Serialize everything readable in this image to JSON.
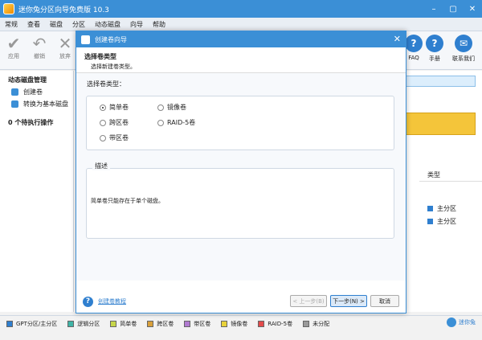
{
  "app": {
    "title": "迷你兔分区向导免费版 10.3"
  },
  "window_controls": [
    "–",
    "▢",
    "✕"
  ],
  "menu": [
    "常规",
    "查看",
    "磁盘",
    "分区",
    "动态磁盘",
    "向导",
    "帮助"
  ],
  "toolbar": {
    "left": [
      {
        "label": "应用",
        "icon": "check-icon"
      },
      {
        "label": "撤销",
        "icon": "undo-icon"
      },
      {
        "label": "放弃",
        "icon": "discard-icon"
      }
    ],
    "right": [
      {
        "label": "FAQ",
        "icon": "faq-icon"
      },
      {
        "label": "手册",
        "icon": "manual-icon"
      },
      {
        "label": "联系我们",
        "icon": "contact-icon"
      }
    ]
  },
  "sidebar": {
    "heading": "动态磁盘管理",
    "items": [
      {
        "label": "创建卷",
        "icon": "create-volume-icon"
      },
      {
        "label": "转换为基本磁盘",
        "icon": "convert-basic-icon"
      }
    ],
    "pending": "0 个待执行操作"
  },
  "main": {
    "type_header": "类型",
    "type_rows": [
      "主分区",
      "主分区"
    ]
  },
  "dialog": {
    "title": "创建卷向导",
    "header_title": "选择卷类型",
    "header_subtitle": "选择新建卷类型。",
    "section_label": "选择卷类型：",
    "options": [
      {
        "label": "简单卷",
        "selected": true
      },
      {
        "label": "镜像卷",
        "selected": false
      },
      {
        "label": "跨区卷",
        "selected": false
      },
      {
        "label": "RAID-5卷",
        "selected": false
      },
      {
        "label": "带区卷",
        "selected": false
      }
    ],
    "desc_label": "描述",
    "desc_text": "简单卷只能存在于单个磁盘。",
    "help_link": "创建卷教程",
    "buttons": {
      "back": "< 上一步(B)",
      "next": "下一步(N) >",
      "cancel": "取消"
    }
  },
  "legend": [
    {
      "label": "GPT分区/主分区",
      "color": "#2f7fcf"
    },
    {
      "label": "逻辑分区",
      "color": "#3fb4a6"
    },
    {
      "label": "简单卷",
      "color": "#c7d64a"
    },
    {
      "label": "跨区卷",
      "color": "#d9a03a"
    },
    {
      "label": "带区卷",
      "color": "#b07ad0"
    },
    {
      "label": "镜像卷",
      "color": "#e8d23a"
    },
    {
      "label": "RAID-5卷",
      "color": "#e34b4b"
    },
    {
      "label": "未分配",
      "color": "#9a9a9a"
    }
  ],
  "brand": "迷你兔"
}
